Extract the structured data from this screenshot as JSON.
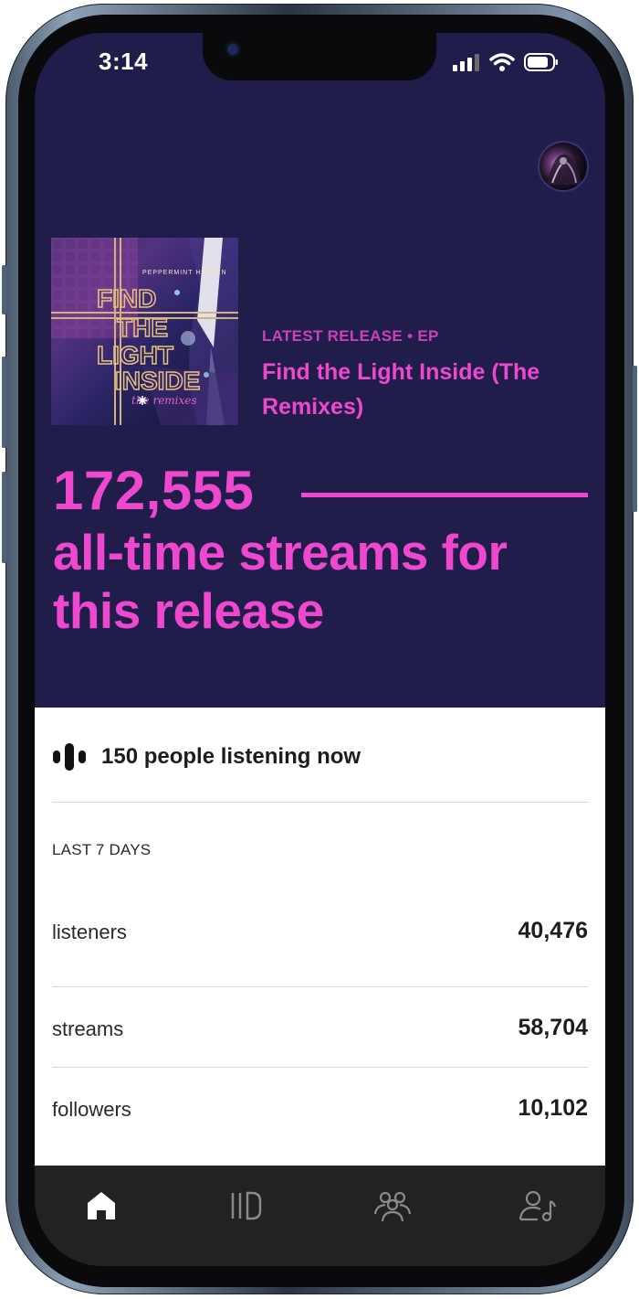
{
  "status_bar": {
    "time": "3:14"
  },
  "release": {
    "meta": "LATEST RELEASE • EP",
    "title": "Find the Light Inside (The Remixes)",
    "album_art": {
      "artist_text": "PEPPERMINT HEAVEN",
      "title_text": "FIND THE LIGHT INSIDE",
      "subtitle_text": "the remixes"
    }
  },
  "hero": {
    "streams": "172,555",
    "streams_label": "all-time streams for this release"
  },
  "listening_now": "150 people listening now",
  "last7": {
    "label": "LAST 7 DAYS",
    "rows": [
      {
        "label": "listeners",
        "value": "40,476"
      },
      {
        "label": "streams",
        "value": "58,704"
      },
      {
        "label": "followers",
        "value": "10,102"
      }
    ]
  },
  "tabbar": {
    "items": [
      {
        "icon": "home-icon",
        "active": true
      },
      {
        "icon": "music-icon",
        "active": false
      },
      {
        "icon": "audience-icon",
        "active": false
      },
      {
        "icon": "profile-icon",
        "active": false
      }
    ]
  },
  "colors": {
    "accent": "#ee48cf",
    "header_bg": "#211d4a",
    "tabbar_bg": "#222222"
  }
}
